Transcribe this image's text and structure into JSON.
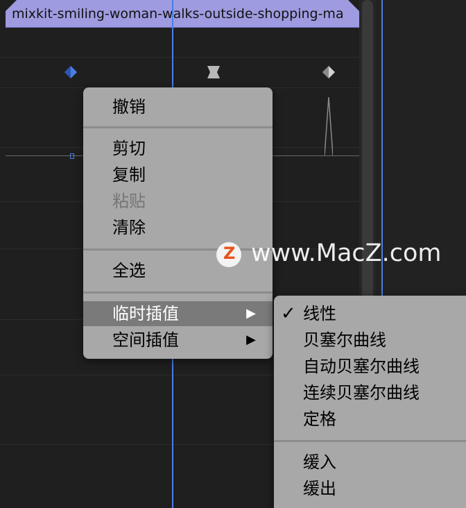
{
  "clip": {
    "title": "mixkit-smiling-woman-walks-outside-shopping-ma"
  },
  "context_menu": {
    "items": [
      {
        "label": "撤销",
        "enabled": true
      },
      {
        "label": "剪切",
        "enabled": true
      },
      {
        "label": "复制",
        "enabled": true
      },
      {
        "label": "粘贴",
        "enabled": false
      },
      {
        "label": "清除",
        "enabled": true
      },
      {
        "label": "全选",
        "enabled": true
      },
      {
        "label": "临时插值",
        "submenu": true,
        "highlighted": true
      },
      {
        "label": "空间插值",
        "submenu": true
      }
    ],
    "submenu_arrow": "▶"
  },
  "interpolation_submenu": {
    "items": [
      {
        "label": "线性",
        "checked": true
      },
      {
        "label": "贝塞尔曲线"
      },
      {
        "label": "自动贝塞尔曲线"
      },
      {
        "label": "连续贝塞尔曲线"
      },
      {
        "label": "定格"
      },
      {
        "label": "缓入"
      },
      {
        "label": "缓出"
      }
    ],
    "check_mark": "✓"
  },
  "watermark": {
    "text": "www.MacZ.com",
    "logo_letter": "Z"
  },
  "colors": {
    "clip_bar": "#9e9be0",
    "playhead": "#4a7ee6",
    "menu_bg": "#a8a8a8",
    "menu_highlight": "#7a7a7a",
    "watermark_logo": "#e8531b"
  }
}
